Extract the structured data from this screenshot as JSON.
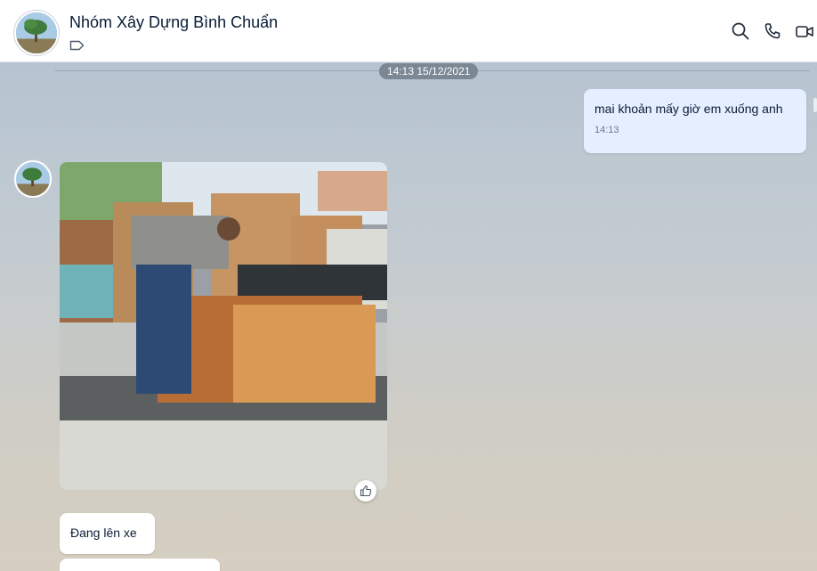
{
  "header": {
    "title": "Nhóm Xây Dựng Bình Chuẩn",
    "icons": [
      "tag-icon",
      "search-icon",
      "phone-icon",
      "video-icon"
    ]
  },
  "chat": {
    "divider_time": "14:13 15/12/2021",
    "outgoing": {
      "text": "mai khoản mấy giờ em xuống anh",
      "time": "14:13"
    },
    "incoming": {
      "text": "Đang lên xe"
    }
  },
  "colors": {
    "accent": "#0068ff",
    "outgoing_bubble": "#e5efff",
    "title_text": "#081c36"
  }
}
